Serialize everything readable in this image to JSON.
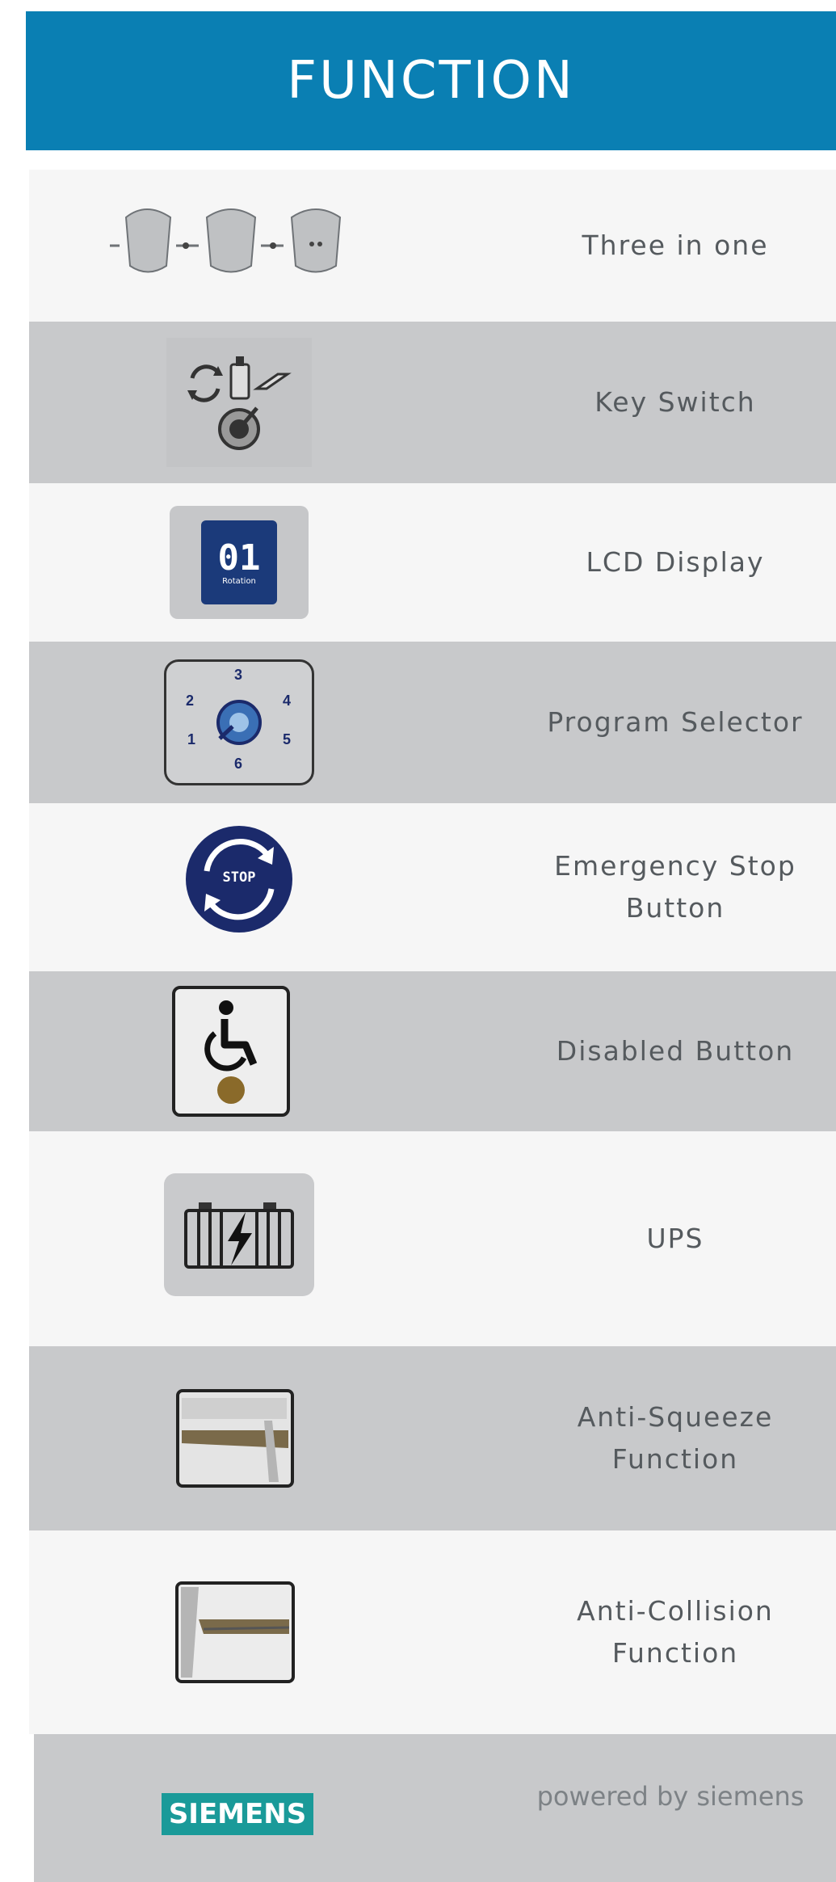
{
  "header": {
    "title": "FUNCTION"
  },
  "features": [
    {
      "label": "Three in one",
      "icon": "three-in-one-icon"
    },
    {
      "label": "Key Switch",
      "icon": "key-switch-icon"
    },
    {
      "label": "LCD Display",
      "icon": "lcd-display-icon",
      "display_text": "01",
      "display_subtext": "Rotation"
    },
    {
      "label": "Program Selector",
      "icon": "program-selector-icon",
      "dial_numbers": [
        "1",
        "2",
        "3",
        "4",
        "5",
        "6"
      ]
    },
    {
      "label": "Emergency Stop\nButton",
      "icon": "emergency-stop-icon",
      "icon_text": "STOP"
    },
    {
      "label": "Disabled Button",
      "icon": "wheelchair-icon"
    },
    {
      "label": "UPS",
      "icon": "battery-icon"
    },
    {
      "label": "Anti-Squeeze\nFunction",
      "icon": "anti-squeeze-icon"
    },
    {
      "label": "Anti-Collision\nFunction",
      "icon": "anti-collision-icon"
    }
  ],
  "footer": {
    "logo_text": "SIEMENS",
    "powered_text": "powered by siemens"
  },
  "colors": {
    "header_bg": "#0a7fb3",
    "row_light": "#f6f6f6",
    "row_dark": "#c8c9cb",
    "siemens_teal": "#1a9a99",
    "icon_navy": "#1b2a6b"
  }
}
